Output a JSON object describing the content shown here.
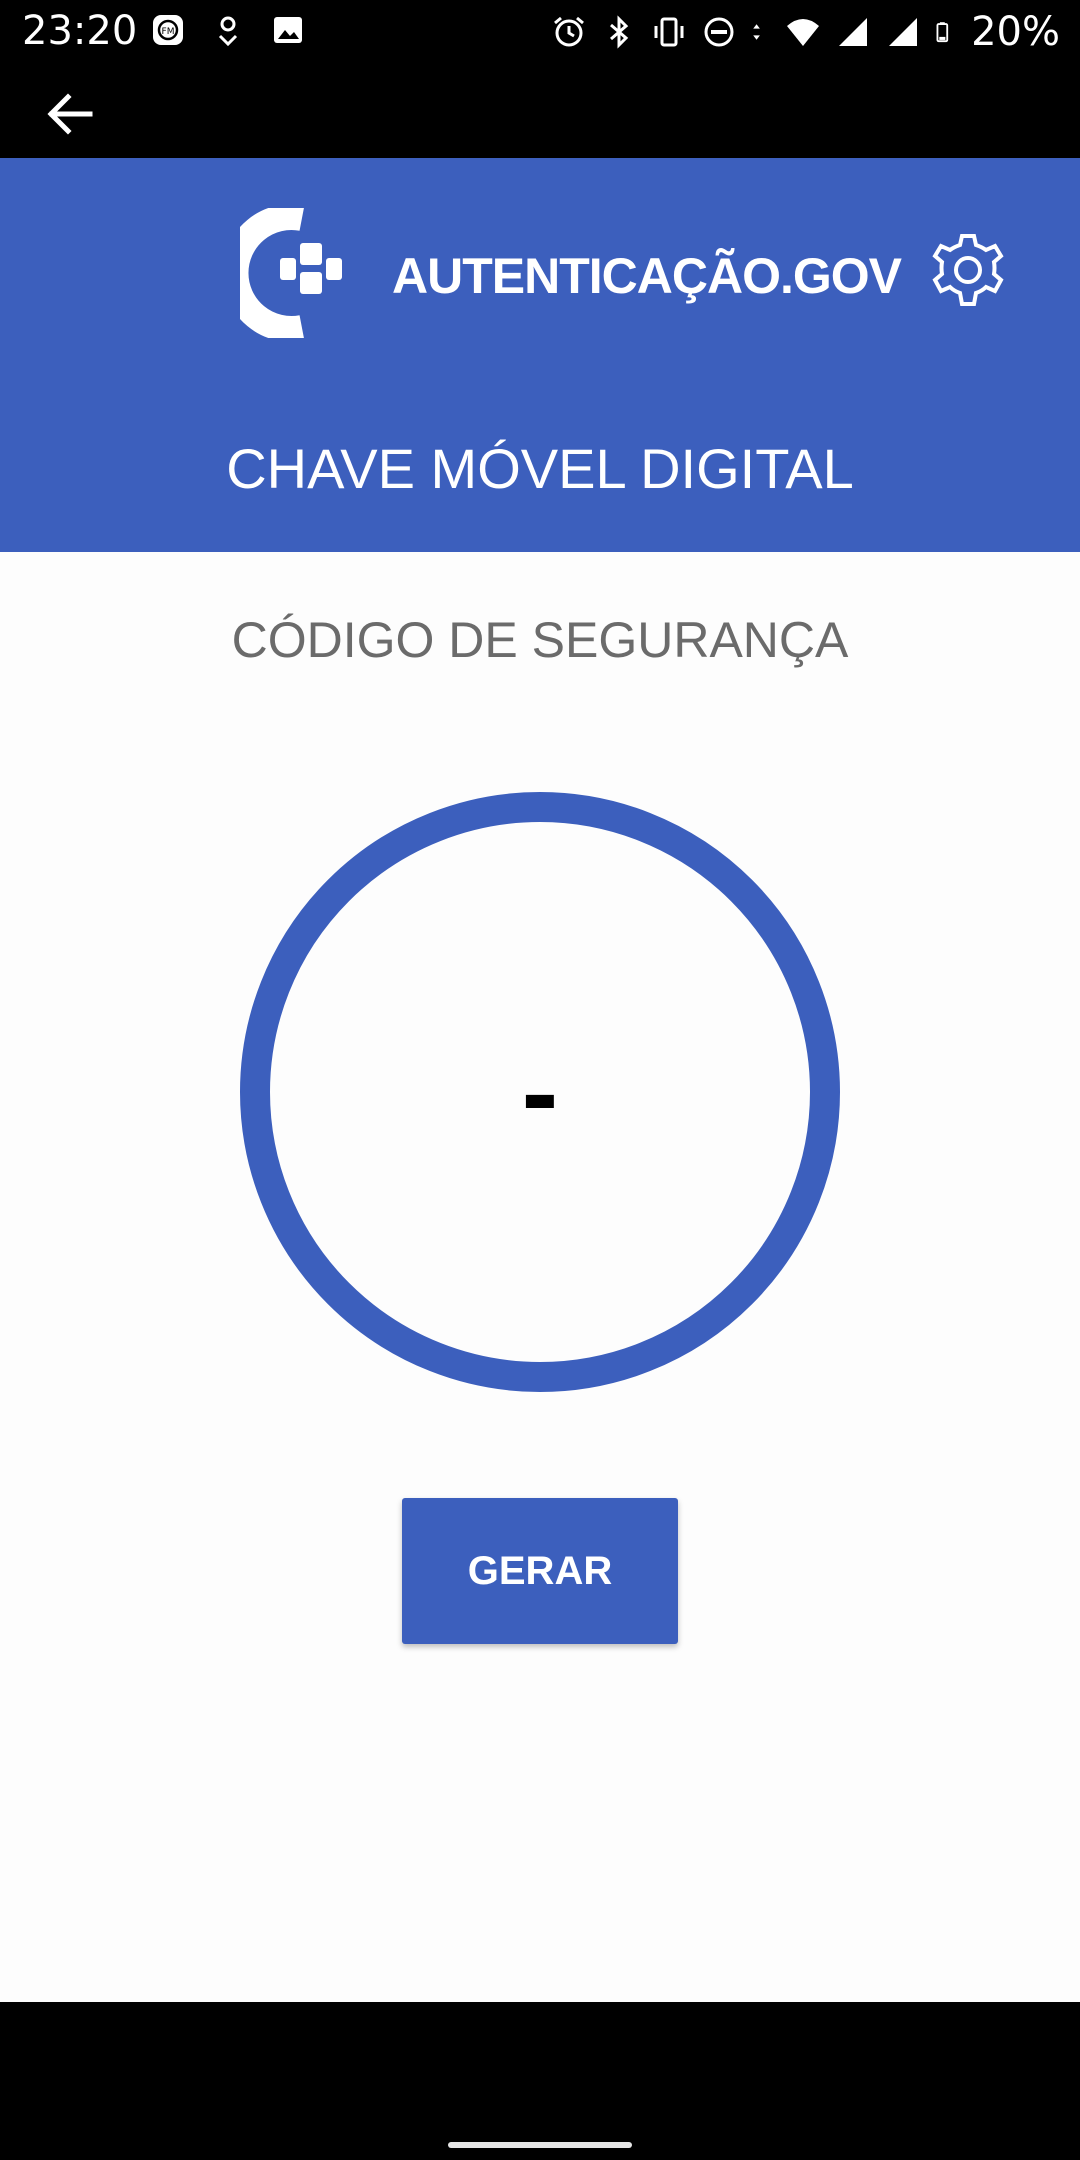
{
  "status_bar": {
    "time": "23:20",
    "battery_text": "20%",
    "left_icons": [
      "fm-radio-icon",
      "location-pin-icon",
      "image-icon"
    ],
    "right_icons": [
      "alarm-icon",
      "bluetooth-icon",
      "vibrate-icon",
      "do-not-disturb-icon",
      "data-arrows-icon",
      "wifi-icon",
      "signal-icon",
      "signal-icon",
      "battery-icon"
    ]
  },
  "toolbar": {
    "back_icon": "arrow-back-icon"
  },
  "header": {
    "brand": "AUTENTICAÇÃO.GOV",
    "title": "CHAVE MÓVEL DIGITAL",
    "settings_icon": "gear-icon"
  },
  "main": {
    "section_title": "CÓDIGO DE SEGURANÇA",
    "code_value": "-",
    "generate_label": "GERAR"
  },
  "colors": {
    "primary": "#3c5fbd",
    "background": "#fdfdfd",
    "section_text": "#6b6b6b"
  }
}
